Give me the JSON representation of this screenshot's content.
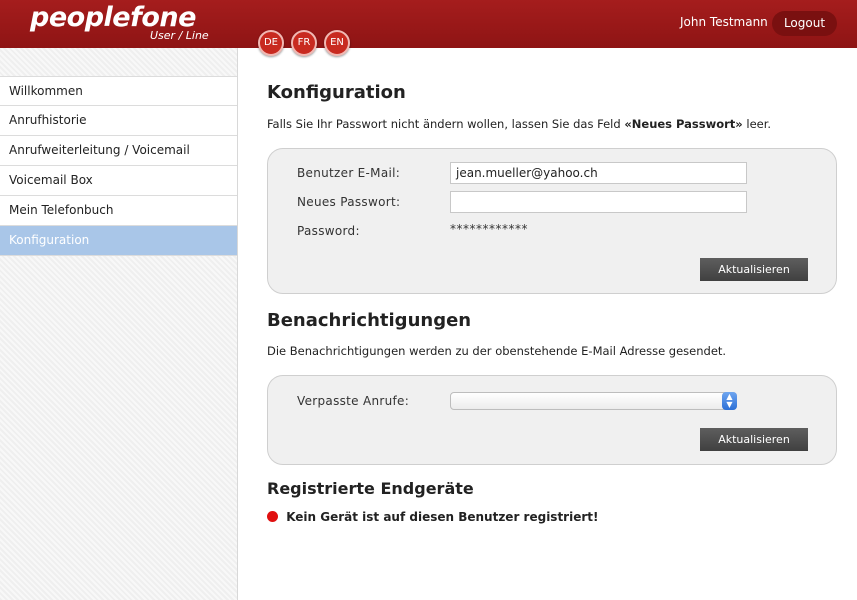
{
  "header": {
    "logo": "peoplefone",
    "logo_sub": "User / Line",
    "languages": [
      "DE",
      "FR",
      "EN"
    ],
    "user_name": "John Testmann",
    "logout_label": "Logout"
  },
  "sidebar": {
    "items": [
      {
        "label": "Willkommen"
      },
      {
        "label": "Anrufhistorie"
      },
      {
        "label": "Anrufweiterleitung / Voicemail"
      },
      {
        "label": "Voicemail Box"
      },
      {
        "label": "Mein Telefonbuch"
      },
      {
        "label": "Konfiguration",
        "active": true
      }
    ]
  },
  "config": {
    "title": "Konfiguration",
    "desc_pre": "Falls Sie Ihr Passwort nicht ändern wollen, lassen Sie das Feld",
    "desc_bold": "«Neues Passwort»",
    "desc_post": "leer.",
    "email_label": "Benutzer E-Mail:",
    "email_value": "jean.mueller@yahoo.ch",
    "new_password_label": "Neues Passwort:",
    "new_password_value": "",
    "password_label": "Password:",
    "password_value": "************",
    "update_label": "Aktualisieren"
  },
  "notifications": {
    "title": "Benachrichtigungen",
    "desc": "Die Benachrichtigungen werden zu der obenstehende E-Mail Adresse gesendet.",
    "missed_calls_label": "Verpasste Anrufe:",
    "missed_calls_value": "",
    "update_label": "Aktualisieren"
  },
  "devices": {
    "title": "Registrierte Endgeräte",
    "status_text": "Kein Gerät ist auf diesen Benutzer registriert!",
    "status_color": "#e01010"
  },
  "colors": {
    "header": "#a51d1d",
    "active_nav": "#a9c6e8",
    "button": "#4a4a4a"
  }
}
